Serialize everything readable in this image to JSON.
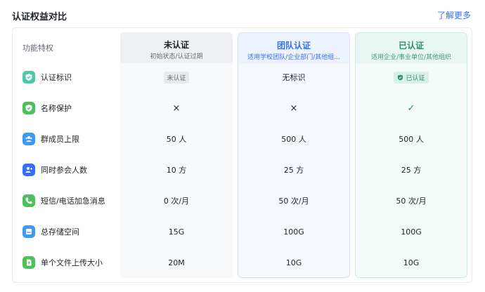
{
  "header": {
    "title": "认证权益对比",
    "more_link": "了解更多"
  },
  "feature_column_header": "功能特权",
  "plans": [
    {
      "name": "未认证",
      "desc": "初始状态/认证过期"
    },
    {
      "name": "团队认证",
      "desc": "适用学校团队/企业部门/其他组..."
    },
    {
      "name": "已认证",
      "desc": "适用企业/事业单位/其他组织"
    }
  ],
  "rows": [
    {
      "feature": "认证标识",
      "icon": "shield-check-icon",
      "icon_color": "#4ec8a8",
      "values": [
        "未认证",
        "无标识",
        "已认证"
      ]
    },
    {
      "feature": "名称保护",
      "icon": "shield-icon",
      "icon_color": "#4cc05a",
      "values": [
        "×",
        "×",
        "✓"
      ]
    },
    {
      "feature": "群成员上限",
      "icon": "group-icon",
      "icon_color": "#3e9bf3",
      "values": [
        "50 人",
        "500 人",
        "500 人"
      ]
    },
    {
      "feature": "同时参会人数",
      "icon": "user-add-icon",
      "icon_color": "#3370ff",
      "values": [
        "10 方",
        "25 方",
        "25 方"
      ]
    },
    {
      "feature": "短信/电话加急消息",
      "icon": "phone-icon",
      "icon_color": "#4cc05a",
      "values": [
        "0 次/月",
        "50 次/月",
        "50 次/月"
      ]
    },
    {
      "feature": "总存储空间",
      "icon": "storage-icon",
      "icon_color": "#3e9bf3",
      "values": [
        "15G",
        "100G",
        "100G"
      ]
    },
    {
      "feature": "单个文件上传大小",
      "icon": "file-upload-icon",
      "icon_color": "#4cc05a",
      "values": [
        "20M",
        "10G",
        "10G"
      ]
    }
  ]
}
